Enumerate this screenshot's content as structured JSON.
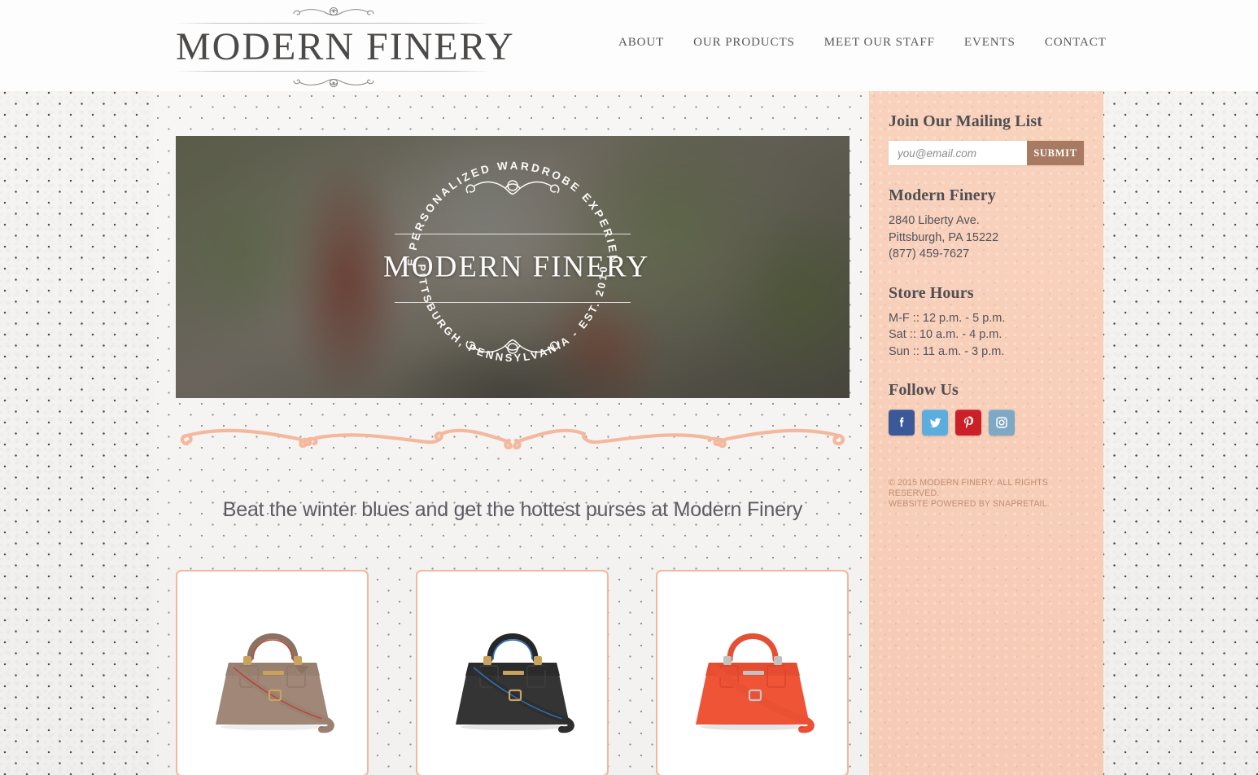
{
  "header": {
    "logo": "MODERN FINERY",
    "ornament_top": "flourish-ornament",
    "ornament_bottom": "flourish-ornament",
    "nav": [
      {
        "label": "ABOUT"
      },
      {
        "label": "OUR PRODUCTS"
      },
      {
        "label": "MEET OUR STAFF"
      },
      {
        "label": "EVENTS"
      },
      {
        "label": "CONTACT"
      }
    ]
  },
  "hero": {
    "badge_top_text": "THE PERSONALIZED WARDROBE EXPERIENCE",
    "badge_name": "MODERN FINERY",
    "badge_bottom_text": "PITTSBURGH, PENNSYLVANIA - EST. 2010",
    "image_alt": "blurred-storefront-photo"
  },
  "main": {
    "divider": "ornamental-flourish-divider",
    "headline": "Beat the winter blues and get the hottest purses at Modern Finery",
    "products": [
      {
        "name": "taupe-handbag",
        "body_color": "#a08778",
        "handle_color": "#8c7263",
        "strap_color": "#9b8172",
        "accent": "#b5463a",
        "hardware": "#c9a35e"
      },
      {
        "name": "black-handbag",
        "body_color": "#343434",
        "handle_color": "#272727",
        "strap_color": "#2e2e2e",
        "accent": "#2f6fb5",
        "hardware": "#c9a35e"
      },
      {
        "name": "coral-handbag",
        "body_color": "#ef5436",
        "handle_color": "#e54f33",
        "strap_color": "#ea5034",
        "accent": "#d8452c",
        "hardware": "#c2c2c2"
      }
    ]
  },
  "sidebar": {
    "mailing_list": {
      "heading": "Join Our Mailing List",
      "placeholder": "you@email.com",
      "value": "",
      "submit_label": "SUBMIT"
    },
    "store": {
      "heading": "Modern Finery",
      "lines": [
        "2840 Liberty Ave.",
        "Pittsburgh, PA 15222",
        "(877) 459-7627"
      ]
    },
    "hours": {
      "heading": "Store Hours",
      "lines": [
        "M-F :: 12 p.m. - 5 p.m.",
        "Sat :: 10 a.m. - 4 p.m.",
        "Sun :: 11 a.m. - 3 p.m."
      ]
    },
    "follow": {
      "heading": "Follow Us",
      "icons": [
        {
          "name": "facebook-icon",
          "color": "#3b5998"
        },
        {
          "name": "twitter-icon",
          "color": "#5badde"
        },
        {
          "name": "pinterest-icon",
          "color": "#cb2027"
        },
        {
          "name": "instagram-icon",
          "color": "#7fa8c4"
        }
      ]
    },
    "copyright_line1": "© 2015 MODERN FINERY. ALL RIGHTS RESERVED.",
    "copyright_line2": "WEBSITE POWERED BY SNAPRETAIL."
  },
  "colors": {
    "sidebar_bg": "#f8cfba",
    "submit_brown": "#a87a62",
    "card_border": "#f2b79c",
    "heading_text": "#514f52",
    "footer_text": "#c08f74"
  }
}
